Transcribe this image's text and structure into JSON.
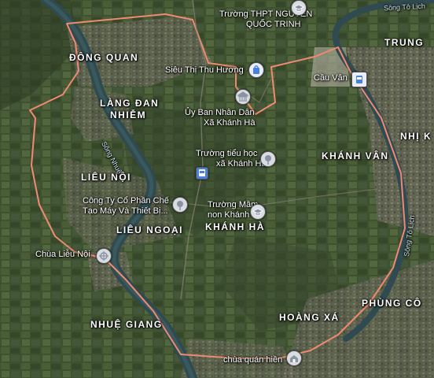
{
  "places": {
    "dong_quan": "ĐÔNG QUAN",
    "lang_dan_nhiem_1": "LÀNG ĐAN",
    "lang_dan_nhiem_2": "NHIỄM",
    "lieu_noi": "LIÊU NỘI",
    "lieu_ngoai": "LIÊU NGOẠI",
    "khanh_ha": "KHÁNH HÀ",
    "khanh_van": "KHÁNH VÂN",
    "trung": "TRUNG",
    "nhi_k": "NHỊ K",
    "nhue_giang": "NHUỆ GIANG",
    "hoang_xa": "HOÀNG XÁ",
    "phung_con": "PHÙNG CÔ"
  },
  "pois": {
    "truong_thpt_1": "Trường THPT NGUYỄN",
    "truong_thpt_2": "QUỐC TRINH",
    "sieu_thi": "Siêu Thị Thu Hương",
    "cau_van": "Cầu Vân",
    "ubnd_1": "Ủy Ban Nhân Dân",
    "ubnd_2": "Xã Khánh Hà",
    "truong_tieu_hoc_1": "Trường tiểu học",
    "truong_tieu_hoc_2": "xã Khánh Hà",
    "cong_ty_1": "Công Ty Cổ Phần Chế",
    "cong_ty_2": "Tạo Máy Và Thiết Bị...",
    "truong_mam_non_1": "Trường Mầm",
    "truong_mam_non_2": "non Khánh Hà",
    "chua_lieu_noi": "Chùa Liễu Nội",
    "chua_quan_hien": "chùa quán hiền"
  },
  "rivers": {
    "song_nhue": "Sông Nhuệ",
    "song_to_lich_top": "Sông Tô Lịch",
    "song_to_lich_right": "Sông Tô Lịch"
  },
  "colors": {
    "boundary": "#f08a70",
    "river": "#2f4a50",
    "pin_blue": "#4a7fe0",
    "pin_gray": "#8a939e"
  }
}
